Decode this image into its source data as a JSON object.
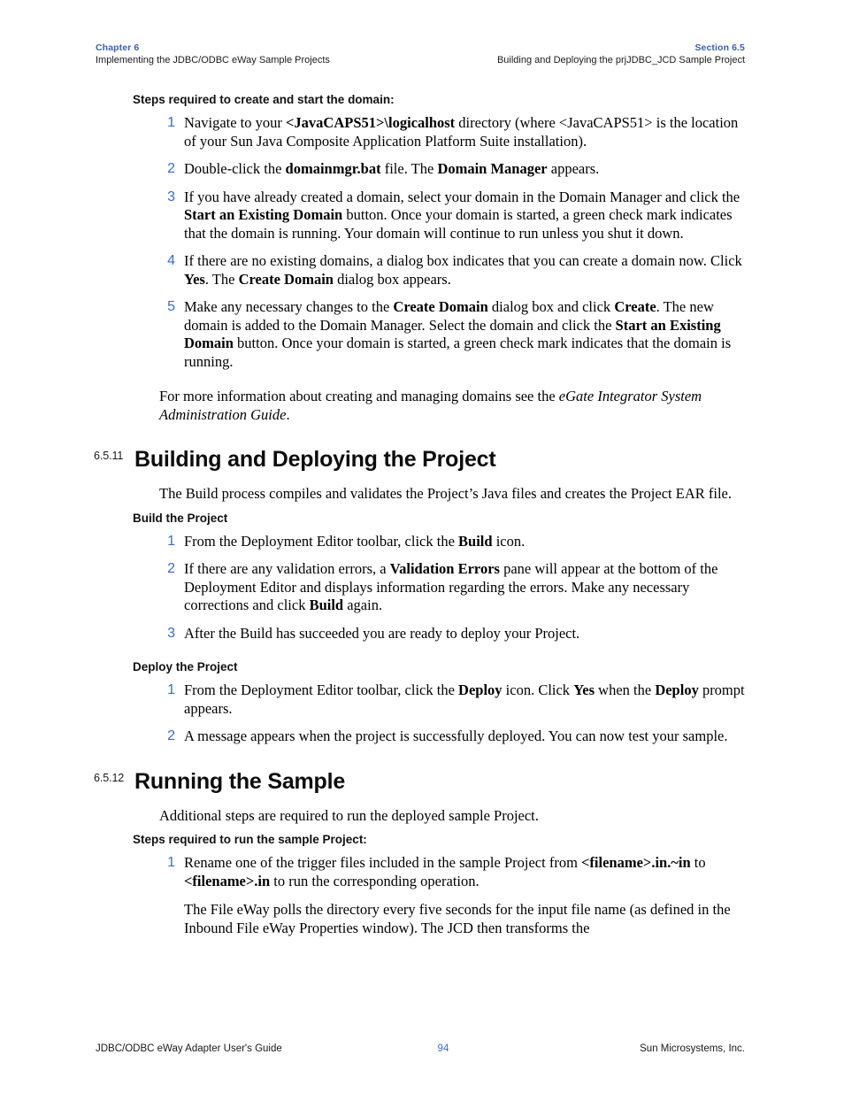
{
  "header": {
    "left_label": "Chapter 6",
    "left_sub": "Implementing the JDBC/ODBC eWay Sample Projects",
    "right_label": "Section 6.5",
    "right_sub": "Building and Deploying the prjJDBC_JCD Sample Project"
  },
  "footer": {
    "left": "JDBC/ODBC eWay Adapter User's Guide",
    "page_number": "94",
    "right": "Sun Microsystems, Inc."
  },
  "colors": {
    "header_blue": "#3a5fb0",
    "list_number_blue": "#3a6bd1",
    "text_black": "#000000"
  },
  "blocks": {
    "domain_steps_heading": "Steps required to create and start the domain:",
    "domain_steps": [
      {
        "num": "1",
        "html": "Navigate to your <b>&lt;JavaCAPS51&gt;\\logicalhost</b> directory (where &lt;JavaCAPS51&gt; is the location of your Sun Java Composite Application Platform Suite installation)."
      },
      {
        "num": "2",
        "html": "Double-click the <b>domainmgr.bat</b> file. The <b>Domain Manager</b> appears."
      },
      {
        "num": "3",
        "html": "If you have already created a domain, select your domain in the Domain Manager and click the <b>Start an Existing Domain</b> button. Once your domain is started, a green check mark indicates that the domain is running. Your domain will continue to run unless you shut it down."
      },
      {
        "num": "4",
        "html": "If there are no existing domains, a dialog box indicates that you can create a domain now. Click <b>Yes</b>. The <b>Create Domain</b> dialog box appears."
      },
      {
        "num": "5",
        "html": "Make any necessary changes to the <b>Create Domain</b> dialog box and click <b>Create</b>. The new domain is added to the Domain Manager. Select the domain and click the <b>Start an Existing Domain</b> button. Once your domain is started, a green check mark indicates that the domain is running."
      }
    ],
    "more_info_html": "For more information about creating and managing domains see the <i>eGate Integrator System Administration Guide</i>.",
    "section_11": {
      "number": "6.5.11",
      "title": "Building and Deploying the Project"
    },
    "build_intro": "The Build process compiles and validates the Project’s Java files and creates the Project EAR file.",
    "build_heading": "Build the Project",
    "build_steps": [
      {
        "num": "1",
        "html": "From the Deployment Editor toolbar, click the <b>Build</b> icon."
      },
      {
        "num": "2",
        "html": "If there are any validation errors, a <b>Validation Errors</b> pane will appear at the bottom of the Deployment Editor and displays information regarding the errors. Make any necessary corrections and click <b>Build</b> again."
      },
      {
        "num": "3",
        "html": "After the Build has succeeded you are ready to deploy your Project."
      }
    ],
    "deploy_heading": "Deploy the Project",
    "deploy_steps": [
      {
        "num": "1",
        "html": "From the Deployment Editor toolbar, click the <b>Deploy</b> icon. Click <b>Yes</b> when the <b>Deploy</b> prompt appears."
      },
      {
        "num": "2",
        "html": "A message appears when the project is successfully deployed. You can now test your sample."
      }
    ],
    "section_12": {
      "number": "6.5.12",
      "title": "Running the Sample"
    },
    "running_intro": "Additional steps are required to run the deployed sample Project.",
    "running_heading": "Steps required to run the sample Project:",
    "running_steps": [
      {
        "num": "1",
        "html": "Rename one of the trigger files included in the sample Project from <b>&lt;filename&gt;.in.~in</b> to <b>&lt;filename&gt;.in</b> to run the corresponding operation.",
        "sub_html": "The File eWay polls the directory every five seconds for the input file name (as defined in the Inbound File eWay Properties window). The JCD then transforms the"
      }
    ]
  }
}
